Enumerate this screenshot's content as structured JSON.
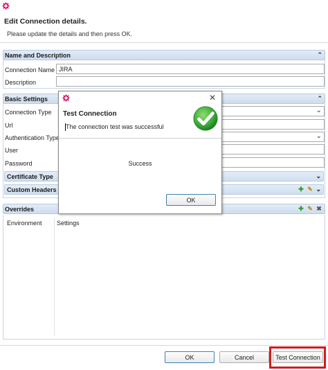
{
  "dialog": {
    "title": "Edit Connection details.",
    "subtitle": "Please update the details and then press OK."
  },
  "name_section": {
    "header": "Name and Description",
    "connection_name_label": "Connection Name",
    "connection_name_value": "JIRA",
    "description_label": "Description",
    "description_value": ""
  },
  "basic_section": {
    "header": "Basic Settings",
    "connection_type_label": "Connection Type",
    "url_label": "Url",
    "auth_type_label": "Authentication Type",
    "user_label": "User",
    "password_label": "Password",
    "certificate_type_header": "Certificate Type",
    "custom_headers_header": "Custom Headers"
  },
  "overrides_section": {
    "header": "Overrides",
    "columns": [
      "Environment",
      "Settings"
    ]
  },
  "buttons": {
    "ok": "OK",
    "cancel": "Cancel",
    "test_connection": "Test Connection"
  },
  "modal": {
    "title": "Test Connection",
    "message": "The connection test was successful",
    "body": "Success",
    "ok": "OK",
    "close_glyph": "✕"
  },
  "chevrons": {
    "up": "⌃",
    "down": "⌄",
    "combo": "⌄"
  },
  "icons": {
    "gear": "gear-icon",
    "success": "check-circle-icon",
    "add": "plus-icon",
    "edit": "edit-icon",
    "delete": "delete-icon"
  },
  "colors": {
    "gear_pink": "#d4146b",
    "success_green": "#3aa83a",
    "highlight_red": "#d11c1c",
    "section_blue": "#cddcee"
  }
}
